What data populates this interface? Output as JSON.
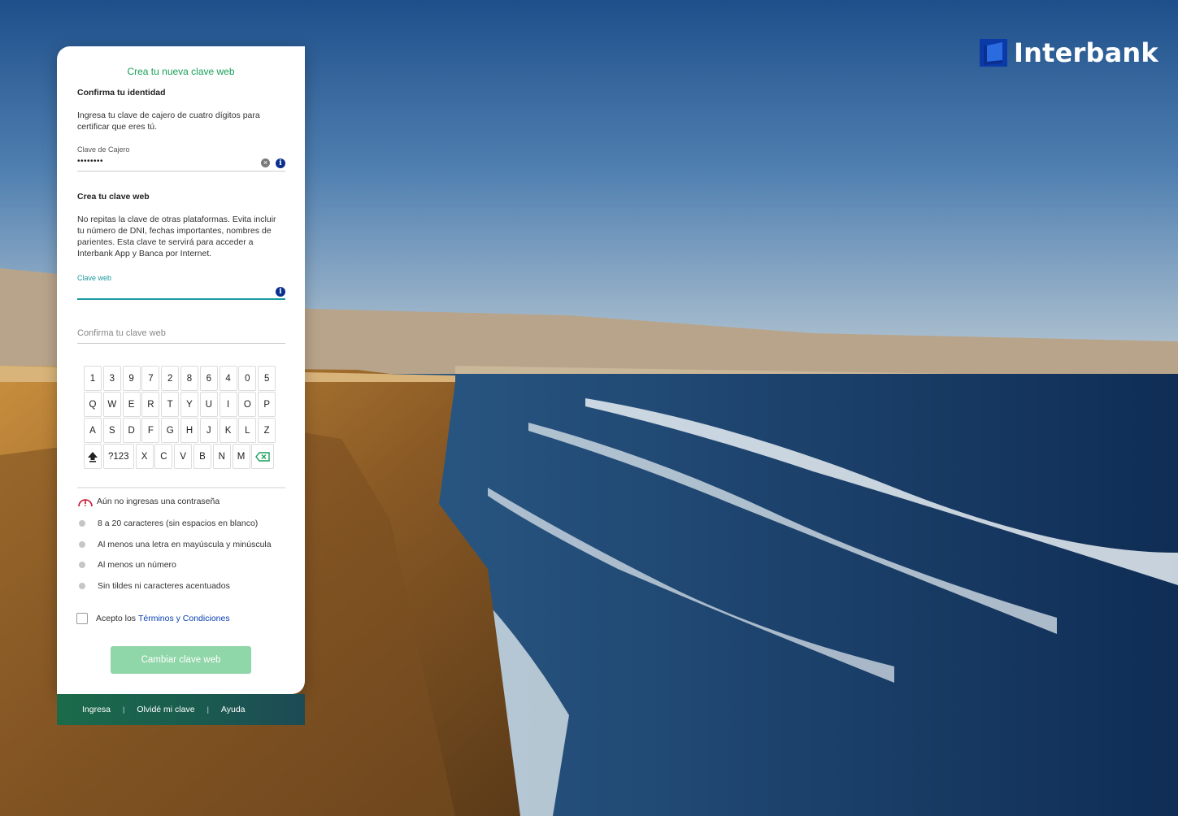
{
  "brand": {
    "name": "Interbank"
  },
  "form": {
    "title": "Crea tu nueva clave web",
    "identity_heading": "Confirma tu identidad",
    "identity_text": "Ingresa tu clave de cajero de cuatro dígitos para certificar que eres tú.",
    "cajero_label": "Clave de Cajero",
    "cajero_value": "••••••••",
    "web_heading": "Crea tu clave web",
    "web_text": "No repitas la clave de otras plataformas. Evita incluir tu número de DNI, fechas importantes, nombres de parientes. Esta clave te servirá para acceder a Interbank App y Banca por Internet.",
    "web_label": "Clave web",
    "confirm_placeholder": "Confirma tu clave web"
  },
  "keyboard": {
    "row1": [
      "1",
      "3",
      "9",
      "7",
      "2",
      "8",
      "6",
      "4",
      "0",
      "5"
    ],
    "row2": [
      "Q",
      "W",
      "E",
      "R",
      "T",
      "Y",
      "U",
      "I",
      "O",
      "P"
    ],
    "row3": [
      "A",
      "S",
      "D",
      "F",
      "G",
      "H",
      "J",
      "K",
      "L",
      "Z"
    ],
    "row4": [
      "X",
      "C",
      "V",
      "B",
      "N",
      "M"
    ],
    "symbols_label": "?123"
  },
  "validation": {
    "status": "Aún no ingresas una contraseña",
    "rules": [
      "8 a 20 caracteres (sin espacios en blanco)",
      "Al menos una letra en mayúscula y minúscula",
      "Al menos un número",
      "Sin tildes ni caracteres acentuados"
    ]
  },
  "terms": {
    "prefix": "Acepto los",
    "link": "Términos y Condiciones"
  },
  "submit_label": "Cambiar clave web",
  "footer": {
    "login": "Ingresa",
    "forgot": "Olvidé mi clave",
    "help": "Ayuda"
  },
  "colors": {
    "accent_green": "#1aa059",
    "teal": "#1a9aa0",
    "brand_blue": "#0a2f8f",
    "button_disabled": "#8fd6a8"
  }
}
